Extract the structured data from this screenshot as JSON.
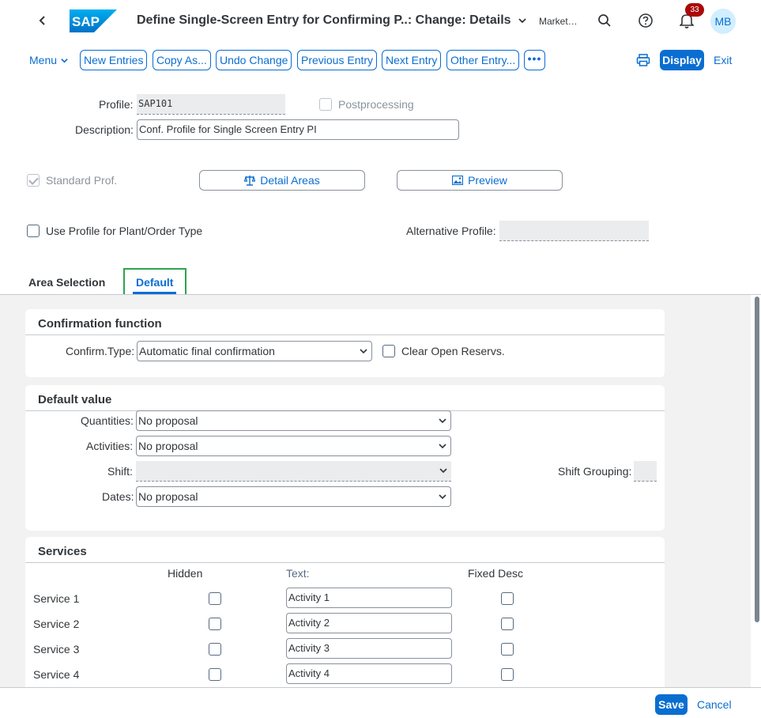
{
  "shell": {
    "title": "Define Single-Screen Entry for Confirming P..: Change: Details",
    "company": "Market…",
    "notification_count": "33",
    "avatar_initials": "MB",
    "logo_text": "SAP"
  },
  "toolbar": {
    "menu_label": "Menu",
    "buttons": [
      "New Entries",
      "Copy As...",
      "Undo Change",
      "Previous Entry",
      "Next Entry",
      "Other Entry..."
    ],
    "more_label": "•••",
    "display_label": "Display",
    "exit_label": "Exit"
  },
  "header": {
    "profile_label": "Profile:",
    "profile_value": "SAP101",
    "postprocessing_label": "Postprocessing",
    "description_label": "Description:",
    "description_value": "Conf. Profile for Single Screen Entry PI",
    "standard_prof_label": "Standard Prof.",
    "detail_areas_label": "Detail Areas",
    "preview_label": "Preview",
    "use_profile_label": "Use Profile for Plant/Order Type",
    "alt_profile_label": "Alternative Profile:",
    "alt_profile_value": ""
  },
  "tabs": {
    "area_selection": "Area Selection",
    "default": "Default"
  },
  "confirmation": {
    "title": "Confirmation function",
    "confirm_type_label": "Confirm.Type:",
    "confirm_type_value": "Automatic final confirmation",
    "clear_open_label": "Clear Open Reservs."
  },
  "default_value": {
    "title": "Default value",
    "quantities_label": "Quantities:",
    "quantities_value": "No proposal",
    "activities_label": "Activities:",
    "activities_value": "No proposal",
    "shift_label": "Shift:",
    "shift_value": "",
    "dates_label": "Dates:",
    "dates_value": "No proposal",
    "shift_grouping_label": "Shift Grouping:"
  },
  "services": {
    "title": "Services",
    "col_hidden": "Hidden",
    "col_text": "Text:",
    "col_fixed": "Fixed Desc",
    "rows": [
      {
        "label": "Service 1",
        "text": "Activity 1"
      },
      {
        "label": "Service 2",
        "text": "Activity 2"
      },
      {
        "label": "Service 3",
        "text": "Activity 3"
      },
      {
        "label": "Service 4",
        "text": "Activity 4"
      }
    ]
  },
  "footer": {
    "save_label": "Save",
    "cancel_label": "Cancel"
  },
  "colors": {
    "accent": "#0a6ed1",
    "badge": "#aa0808",
    "focus_outline": "#2da44e"
  }
}
